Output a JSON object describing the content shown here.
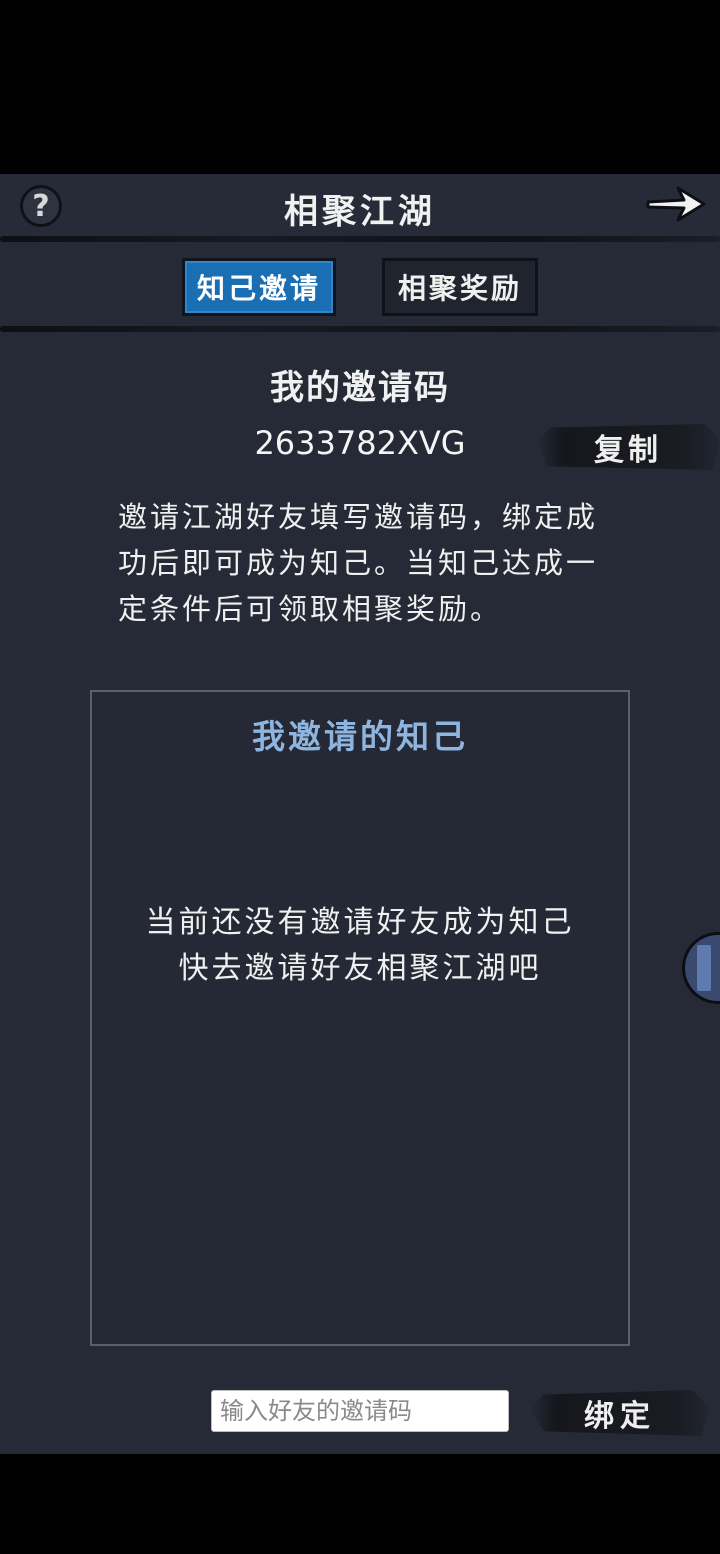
{
  "header": {
    "title": "相聚江湖",
    "help_icon": "question-mark-icon",
    "next_icon": "arrow-right-icon"
  },
  "tabs": [
    {
      "label": "知己邀请",
      "active": true
    },
    {
      "label": "相聚奖励",
      "active": false
    }
  ],
  "my_code": {
    "heading": "我的邀请码",
    "code": "2633782XVG",
    "copy_label": "复制"
  },
  "description": "邀请江湖好友填写邀请码，绑定成功后即可成为知己。当知己达成一定条件后可领取相聚奖励。",
  "friends": {
    "heading": "我邀请的知己",
    "empty_line1": "当前还没有邀请好友成为知己",
    "empty_line2": "快去邀请好友相聚江湖吧"
  },
  "bind": {
    "placeholder": "输入好友的邀请码",
    "value": "",
    "button_label": "绑定"
  },
  "colors": {
    "background": "#252a36",
    "active_tab": "#1a6fb4",
    "friends_heading": "#8fb4de"
  }
}
